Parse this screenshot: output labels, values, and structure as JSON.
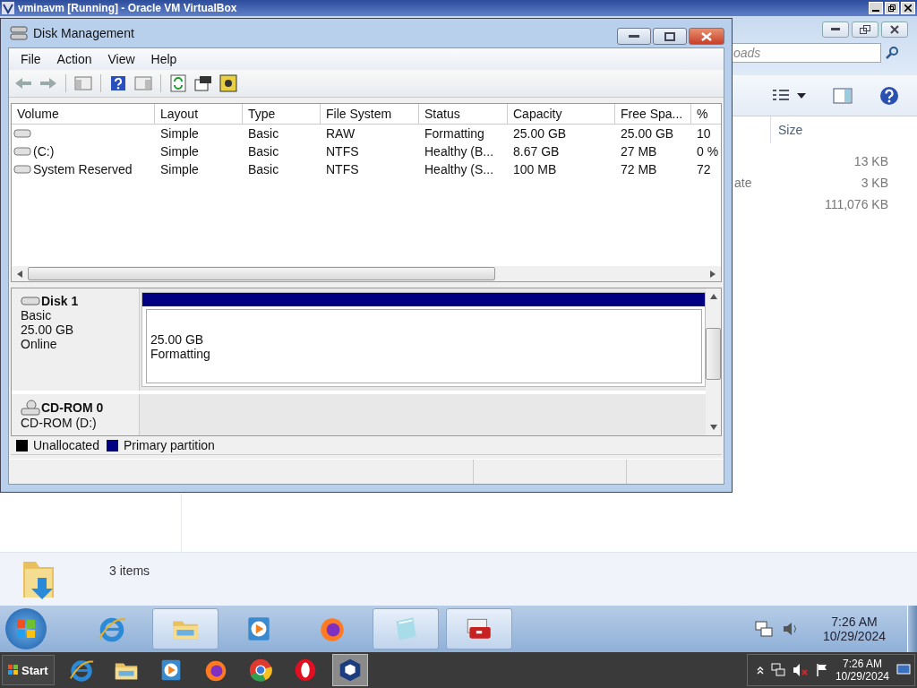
{
  "host_window": {
    "title": "vminavm [Running] - Oracle VM VirtualBox"
  },
  "explorer": {
    "search": {
      "placeholder": "oads"
    },
    "columns": [
      "Size"
    ],
    "rows": [
      {
        "name_part": "",
        "size": "13 KB"
      },
      {
        "name_part": "ate",
        "size": "3 KB"
      },
      {
        "name_part": "",
        "size": "111,076 KB"
      }
    ],
    "status": "3 items"
  },
  "disk_management": {
    "title": "Disk Management",
    "menu": [
      "File",
      "Action",
      "View",
      "Help"
    ],
    "volume_columns": [
      "Volume",
      "Layout",
      "Type",
      "File System",
      "Status",
      "Capacity",
      "Free Spa...",
      "%"
    ],
    "volumes": [
      {
        "cells": [
          "",
          "Simple",
          "Basic",
          "RAW",
          "Formatting",
          "25.00 GB",
          "25.00 GB",
          "10"
        ]
      },
      {
        "cells": [
          "(C:)",
          "Simple",
          "Basic",
          "NTFS",
          "Healthy (B...",
          "8.67 GB",
          "27 MB",
          "0 %"
        ]
      },
      {
        "cells": [
          "System Reserved",
          "Simple",
          "Basic",
          "NTFS",
          "Healthy (S...",
          "100 MB",
          "72 MB",
          "72"
        ]
      }
    ],
    "disks": [
      {
        "kind": "disk",
        "name": "Disk 1",
        "lines": [
          "Basic",
          "25.00 GB",
          "Online"
        ],
        "partitions": [
          {
            "size": "25.00 GB",
            "status": "Formatting",
            "color": "#000080"
          }
        ]
      },
      {
        "kind": "cdrom",
        "name": "CD-ROM 0",
        "lines": [
          "CD-ROM (D:)"
        ]
      }
    ],
    "legend": [
      {
        "label": "Unallocated",
        "color": "#000000"
      },
      {
        "label": "Primary partition",
        "color": "#000080"
      }
    ]
  },
  "guest_taskbar": {
    "items": [
      {
        "kind": "ie",
        "selected": false
      },
      {
        "kind": "folder",
        "selected": true
      },
      {
        "kind": "media",
        "selected": false
      },
      {
        "kind": "firefox",
        "selected": false
      },
      {
        "kind": "notepad",
        "selected": true
      },
      {
        "kind": "toolbox",
        "selected": true
      }
    ],
    "time": "7:26 AM",
    "date": "10/29/2024"
  },
  "host_taskbar": {
    "start": "Start",
    "items": [
      {
        "kind": "ie",
        "selected": false
      },
      {
        "kind": "folder",
        "selected": false
      },
      {
        "kind": "media",
        "selected": false
      },
      {
        "kind": "firefox",
        "selected": false
      },
      {
        "kind": "chrome",
        "selected": false
      },
      {
        "kind": "opera",
        "selected": false
      },
      {
        "kind": "virtualbox",
        "selected": true
      }
    ],
    "time": "7:26 AM",
    "date": "10/29/2024"
  }
}
